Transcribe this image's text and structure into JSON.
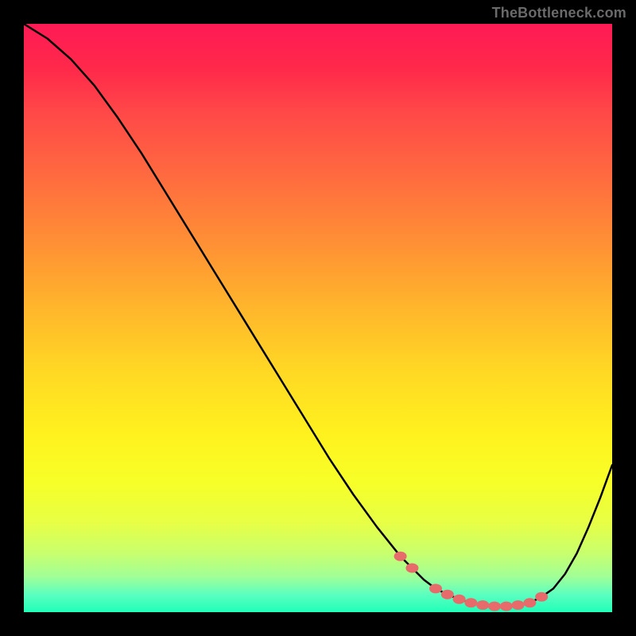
{
  "watermark": "TheBottleneck.com",
  "chart_data": {
    "type": "line",
    "title": "",
    "xlabel": "",
    "ylabel": "",
    "xlim": [
      0,
      100
    ],
    "ylim": [
      0,
      100
    ],
    "grid": false,
    "legend": false,
    "series": [
      {
        "name": "curve",
        "color": "#000000",
        "x": [
          0,
          4,
          8,
          12,
          16,
          20,
          24,
          28,
          32,
          36,
          40,
          44,
          48,
          52,
          56,
          60,
          64,
          68,
          70,
          72,
          74,
          76,
          78,
          80,
          82,
          84,
          86,
          88,
          90,
          92,
          94,
          96,
          98,
          100
        ],
        "y": [
          100,
          97.5,
          94,
          89.5,
          84,
          78,
          71.5,
          65,
          58.5,
          52,
          45.5,
          39,
          32.5,
          26,
          20,
          14.5,
          9.5,
          5.5,
          4,
          3,
          2.2,
          1.6,
          1.2,
          1,
          1,
          1.2,
          1.6,
          2.6,
          4,
          6.5,
          10,
          14.5,
          19.5,
          25
        ]
      },
      {
        "name": "markers",
        "type": "scatter",
        "color": "#e76b6b",
        "x": [
          64,
          66,
          70,
          72,
          74,
          76,
          78,
          80,
          82,
          84,
          86,
          88
        ],
        "y": [
          9.5,
          7.5,
          4,
          3,
          2.2,
          1.6,
          1.2,
          1,
          1,
          1.2,
          1.6,
          2.6
        ]
      }
    ]
  }
}
